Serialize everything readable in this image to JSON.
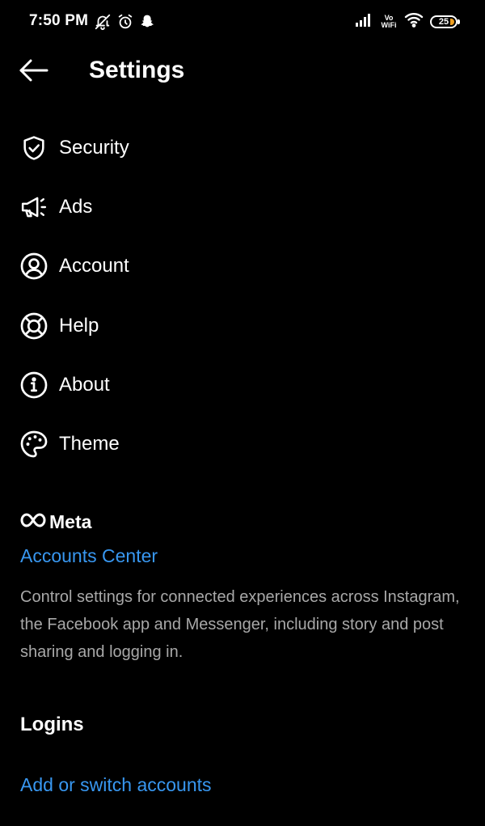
{
  "status_bar": {
    "time": "7:50 PM",
    "left_icons": [
      "bell-off-icon",
      "alarm-icon",
      "snapchat-icon"
    ],
    "right_icons": [
      "signal-icon",
      "vowifi-icon",
      "wifi-icon",
      "battery-icon"
    ],
    "vowifi_top": "Vo",
    "vowifi_bottom": "WiFi",
    "battery_level": "25",
    "battery_accent": "#f0a020"
  },
  "header": {
    "title": "Settings",
    "back_icon": "arrow-left-icon"
  },
  "menu": {
    "items": [
      {
        "label": "Security",
        "icon": "shield-check-icon"
      },
      {
        "label": "Ads",
        "icon": "megaphone-icon"
      },
      {
        "label": "Account",
        "icon": "user-circle-icon"
      },
      {
        "label": "Help",
        "icon": "lifebuoy-icon"
      },
      {
        "label": "About",
        "icon": "info-icon"
      },
      {
        "label": "Theme",
        "icon": "palette-icon"
      }
    ]
  },
  "meta": {
    "brand": "Meta",
    "brand_icon": "meta-infinity-icon",
    "accounts_center": "Accounts Center",
    "description": "Control settings for connected experiences across Instagram, the Facebook app and Messenger, including story and post sharing and logging in."
  },
  "logins": {
    "heading": "Logins",
    "add_switch": "Add or switch accounts"
  },
  "colors": {
    "background": "#000000",
    "text": "#ffffff",
    "link": "#3897f0",
    "muted": "#a8a8a8"
  }
}
